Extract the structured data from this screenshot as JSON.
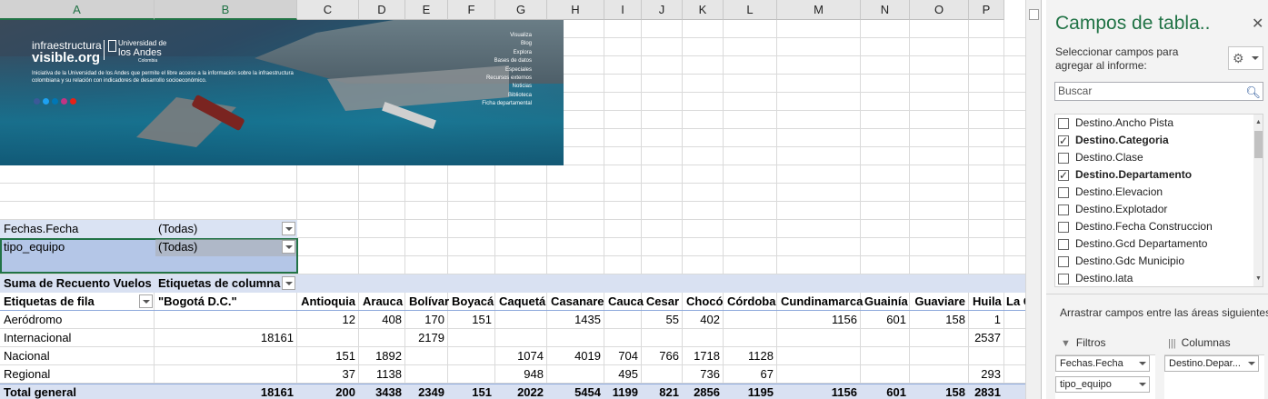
{
  "sheet": {
    "columns": [
      "A",
      "B",
      "C",
      "D",
      "E",
      "F",
      "G",
      "H",
      "I",
      "J",
      "K",
      "L",
      "M",
      "N",
      "O",
      "P"
    ],
    "selected_columns": [
      "A",
      "B"
    ],
    "banner": {
      "brand_line1": "infraestructura",
      "brand_line2": "visible.org",
      "university_small": "Universidad de",
      "university_big": "los Andes",
      "university_country": "Colombia",
      "description": "Iniciativa de la Universidad de los Andes que permite el libre acceso a la información sobre la infraestructura colombiana y su relación con indicadores de desarrollo socioeconómico.",
      "menu": [
        "Visualiza",
        "Blog",
        "Explora",
        "Bases de datos",
        "Especiales",
        "Recursos externos",
        "Noticias",
        "Biblioteca",
        "Ficha departamental"
      ]
    },
    "filters": [
      {
        "field": "Fechas.Fecha",
        "value": "(Todas)"
      },
      {
        "field": "tipo_equipo",
        "value": "(Todas)"
      }
    ],
    "pivot": {
      "values_label": "Suma de Recuento Vuelos",
      "columns_label": "Etiquetas de columna",
      "rows_label": "Etiquetas de fila",
      "headers": [
        "\"Bogotá D.C.\"",
        "Antioquia",
        "Arauca",
        "Bolívar",
        "Boyacá",
        "Caquetá",
        "Casanare",
        "Cauca",
        "Cesar",
        "Chocó",
        "Córdoba",
        "Cundinamarca",
        "Guainía",
        "Guaviare",
        "Huila",
        "La G"
      ],
      "rows": [
        {
          "label": "Aeródromo",
          "values": [
            "",
            "12",
            "408",
            "170",
            "151",
            "",
            "1435",
            "",
            "55",
            "402",
            "",
            "1156",
            "601",
            "158",
            "1"
          ]
        },
        {
          "label": "Internacional",
          "values": [
            "18161",
            "",
            "",
            "2179",
            "",
            "",
            "",
            "",
            "",
            "",
            "",
            "",
            "",
            "",
            "2537"
          ]
        },
        {
          "label": "Nacional",
          "values": [
            "",
            "151",
            "1892",
            "",
            "",
            "1074",
            "4019",
            "704",
            "766",
            "1718",
            "1128",
            "",
            "",
            "",
            ""
          ]
        },
        {
          "label": "Regional",
          "values": [
            "",
            "37",
            "1138",
            "",
            "",
            "948",
            "",
            "495",
            "",
            "736",
            "67",
            "",
            "",
            "",
            "293"
          ]
        }
      ],
      "total": {
        "label": "Total general",
        "values": [
          "18161",
          "200",
          "3438",
          "2349",
          "151",
          "2022",
          "5454",
          "1199",
          "821",
          "2856",
          "1195",
          "1156",
          "601",
          "158",
          "2831"
        ]
      }
    }
  },
  "panel": {
    "title": "Campos de tabla..",
    "hint": "Seleccionar campos para agregar al informe:",
    "search_placeholder": "Buscar",
    "fields": [
      {
        "label": "Destino.Ancho Pista",
        "checked": false
      },
      {
        "label": "Destino.Categoria",
        "checked": true
      },
      {
        "label": "Destino.Clase",
        "checked": false
      },
      {
        "label": "Destino.Departamento",
        "checked": true
      },
      {
        "label": "Destino.Elevacion",
        "checked": false
      },
      {
        "label": "Destino.Explotador",
        "checked": false
      },
      {
        "label": "Destino.Fecha Construccion",
        "checked": false
      },
      {
        "label": "Destino.Gcd Departamento",
        "checked": false
      },
      {
        "label": "Destino.Gdc Municipio",
        "checked": false
      },
      {
        "label": "Destino.lata",
        "checked": false
      }
    ],
    "drag_hint": "Arrastrar campos entre las áreas siguientes:",
    "filters_area": {
      "title": "Filtros",
      "items": [
        "Fechas.Fecha",
        "tipo_equipo"
      ]
    },
    "columns_area": {
      "title": "Columnas",
      "items": [
        "Destino.Depar..."
      ]
    }
  }
}
